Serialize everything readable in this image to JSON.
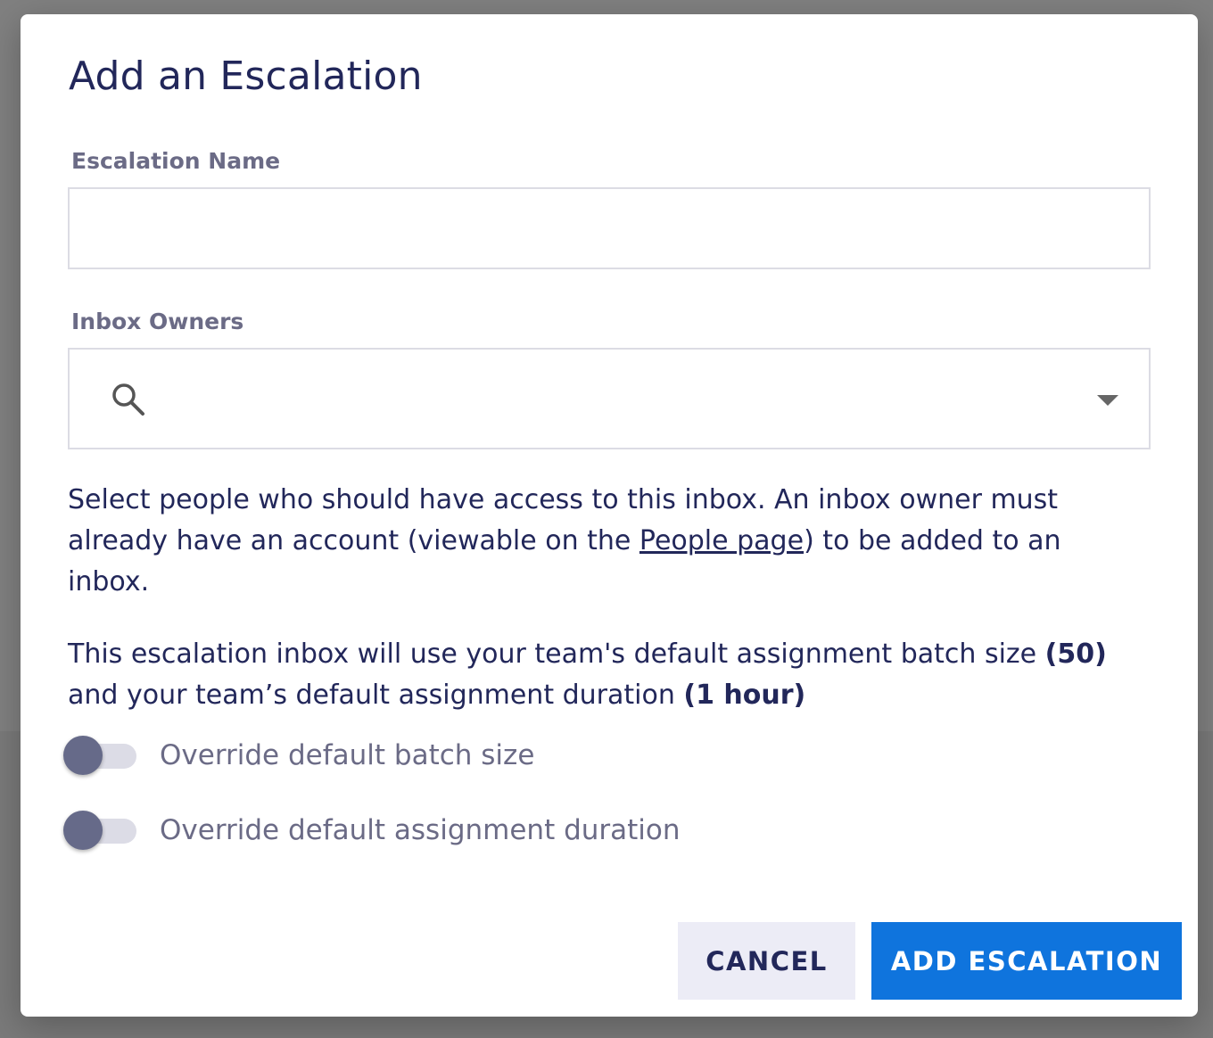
{
  "modal": {
    "title": "Add an Escalation",
    "escalation_name": {
      "label": "Escalation Name",
      "value": "",
      "placeholder": ""
    },
    "inbox_owners": {
      "label": "Inbox Owners",
      "value": "",
      "icon": "search-icon",
      "dropdown_icon": "chevron-down-icon"
    },
    "help": {
      "before_link": "Select people who should have access to this inbox. An inbox owner must already have an account (viewable on the ",
      "link_text": "People page",
      "after_link": ") to be added to an inbox."
    },
    "info": {
      "part1": "This escalation inbox will use your team's default assignment batch size ",
      "batch_size": "(50)",
      "part2": " and your team’s default assignment duration ",
      "duration": "(1 hour)"
    },
    "toggles": [
      {
        "label": "Override default batch size",
        "on": false
      },
      {
        "label": "Override default assignment duration",
        "on": false
      }
    ],
    "buttons": {
      "cancel": "CANCEL",
      "add": "ADD ESCALATION"
    }
  },
  "colors": {
    "primary": "#0f74dd",
    "text": "#22275a",
    "muted": "#6b6b86",
    "cancel_bg": "#ececf6"
  }
}
